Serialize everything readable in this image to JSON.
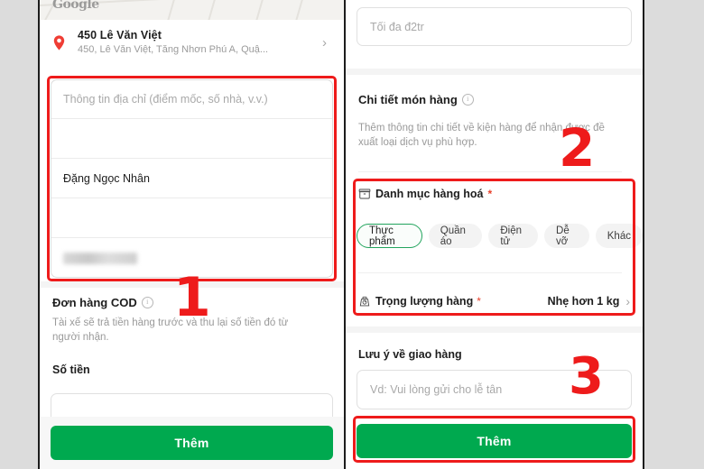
{
  "app": {
    "brand_green": "#00a94f",
    "annotation_red": "#ee1b1b",
    "chip_selected_border": "#22a45d"
  },
  "left_panel": {
    "map": {
      "watermark": "Google"
    },
    "address": {
      "pin_icon": "location-pin-icon",
      "title": "450 Lê Văn Việt",
      "subtitle": "450, Lê Văn Việt, Tăng Nhơn Phú A, Quậ...",
      "chevron": "›"
    },
    "fields": [
      {
        "name": "address-detail",
        "placeholder": "Thông tin địa chỉ (điểm mốc, số nhà, v.v.)",
        "value": ""
      },
      {
        "name": "address-extra",
        "placeholder": "",
        "value": ""
      },
      {
        "name": "recipient-name",
        "placeholder": "",
        "value": "Đặng Ngọc Nhân"
      },
      {
        "name": "recipient-extra",
        "placeholder": "",
        "value": ""
      },
      {
        "name": "recipient-phone",
        "placeholder": "",
        "value": "",
        "redacted": true
      }
    ],
    "cod": {
      "title": "Đơn hàng COD",
      "info_icon": "info-icon",
      "description": "Tài xế sẽ trả tiền hàng trước và thu lại số tiền đó từ người nhận.",
      "amount_label": "Số tiền",
      "amount_placeholder": "",
      "amount_value": ""
    },
    "cta_label": "Thêm"
  },
  "right_panel": {
    "amount_input": {
      "placeholder": "Tối đa đ2tr",
      "value": ""
    },
    "item_details": {
      "title": "Chi tiết món hàng",
      "info_icon": "info-icon",
      "description": "Thêm thông tin chi tiết về kiện hàng để nhận được đề xuất loại dịch vụ phù hợp."
    },
    "category": {
      "icon": "package-box-icon",
      "label": "Danh mục hàng hoá",
      "required_mark": "*",
      "options": [
        "Thực phẩm",
        "Quần áo",
        "Điện tử",
        "Dễ vỡ",
        "Khác"
      ],
      "selected": "Thực phẩm"
    },
    "weight": {
      "icon": "weighing-scale-icon",
      "label": "Trọng lượng hàng",
      "required_mark": "*",
      "value": "Nhẹ hơn 1 kg",
      "chevron": "›"
    },
    "delivery_note": {
      "label": "Lưu ý về giao hàng",
      "placeholder": "Vd: Vui lòng gửi cho lễ tân",
      "value": ""
    },
    "cta_label": "Thêm"
  },
  "annotations": [
    {
      "number": "1"
    },
    {
      "number": "2"
    },
    {
      "number": "3"
    }
  ]
}
